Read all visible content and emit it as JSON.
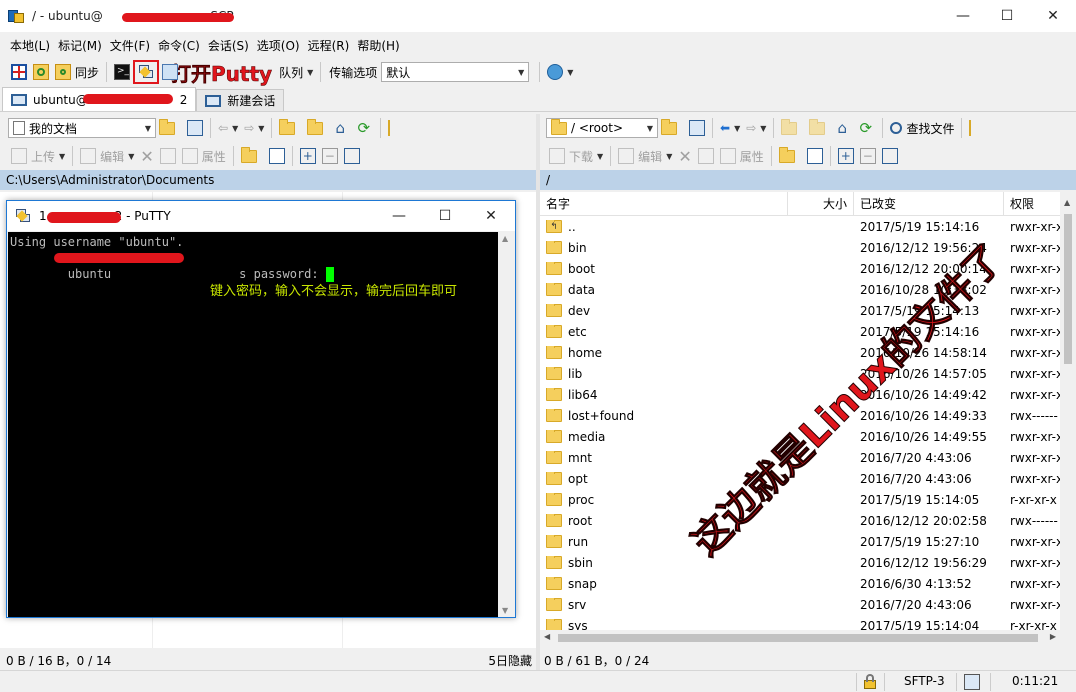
{
  "window": {
    "title_prefix": "/ - ubuntu@",
    "title_suffix": "nSCP",
    "minimize": "—",
    "maximize": "☐",
    "close": "✕"
  },
  "menu": [
    "本地(L)",
    "标记(M)",
    "文件(F)",
    "命令(C)",
    "会话(S)",
    "选项(O)",
    "远程(R)",
    "帮助(H)"
  ],
  "toolbar": {
    "sync_label": "同步",
    "queue_label": "队列",
    "transfer_label": "传输选项",
    "transfer_value": "默认"
  },
  "annotations": {
    "open_putty": "打开Putty",
    "linux_files": "这边就是Linux的文件了",
    "password_hint": "键入密码，输入不会显示，输完后回车即可"
  },
  "tabs": {
    "session_prefix": "ubuntu@",
    "session_suffix": "2",
    "new_session": "新建会话"
  },
  "left_panel": {
    "location": "我的文档",
    "upload": "上传",
    "edit": "编辑",
    "properties": "属性",
    "path": "C:\\Users\\Administrator\\Documents",
    "status": "0 B / 16 B，0 / 14",
    "hidden": "5日隐藏"
  },
  "right_panel": {
    "location": "/  <root>",
    "find_files": "查找文件",
    "download": "下载",
    "edit": "编辑",
    "properties": "属性",
    "path": "/",
    "columns": [
      "名字",
      "大小",
      "已改变",
      "权限"
    ],
    "files": [
      {
        "name": "..",
        "changed": "2017/5/19 15:14:16",
        "perm": "rwxr-xr-x",
        "up": true
      },
      {
        "name": "bin",
        "changed": "2016/12/12 19:56:24",
        "perm": "rwxr-xr-x"
      },
      {
        "name": "boot",
        "changed": "2016/12/12 20:00:14",
        "perm": "rwxr-xr-x"
      },
      {
        "name": "data",
        "changed": "2016/10/28 10:38:02",
        "perm": "rwxr-xr-x"
      },
      {
        "name": "dev",
        "changed": "2017/5/19 15:14:13",
        "perm": "rwxr-xr-x"
      },
      {
        "name": "etc",
        "changed": "2017/5/19 15:14:16",
        "perm": "rwxr-xr-x"
      },
      {
        "name": "home",
        "changed": "2016/10/26 14:58:14",
        "perm": "rwxr-xr-x"
      },
      {
        "name": "lib",
        "changed": "2016/10/26 14:57:05",
        "perm": "rwxr-xr-x"
      },
      {
        "name": "lib64",
        "changed": "2016/10/26 14:49:42",
        "perm": "rwxr-xr-x"
      },
      {
        "name": "lost+found",
        "changed": "2016/10/26 14:49:33",
        "perm": "rwx------"
      },
      {
        "name": "media",
        "changed": "2016/10/26 14:49:55",
        "perm": "rwxr-xr-x"
      },
      {
        "name": "mnt",
        "changed": "2016/7/20 4:43:06",
        "perm": "rwxr-xr-x"
      },
      {
        "name": "opt",
        "changed": "2016/7/20 4:43:06",
        "perm": "rwxr-xr-x"
      },
      {
        "name": "proc",
        "changed": "2017/5/19 15:14:05",
        "perm": "r-xr-xr-x"
      },
      {
        "name": "root",
        "changed": "2016/12/12 20:02:58",
        "perm": "rwx------"
      },
      {
        "name": "run",
        "changed": "2017/5/19 15:27:10",
        "perm": "rwxr-xr-x"
      },
      {
        "name": "sbin",
        "changed": "2016/12/12 19:56:29",
        "perm": "rwxr-xr-x"
      },
      {
        "name": "snap",
        "changed": "2016/6/30 4:13:52",
        "perm": "rwxr-xr-x"
      },
      {
        "name": "srv",
        "changed": "2016/7/20 4:43:06",
        "perm": "rwxr-xr-x"
      },
      {
        "name": "sys",
        "changed": "2017/5/19 15:14:04",
        "perm": "r-xr-xr-x"
      }
    ],
    "status": "0 B / 61 B，0 / 24"
  },
  "bottom": {
    "protocol": "SFTP-3",
    "time": "0:11:21"
  },
  "putty": {
    "title_prefix": "1",
    "title_suffix": "2 - PuTTY",
    "line1": "Using username \"ubuntu\".",
    "line2_prefix": "ubuntu",
    "line2_suffix": "s password: "
  },
  "colors": {
    "accent_red": "#e0161c",
    "path_bar": "#bcd2e8",
    "terminal_bg": "#000000",
    "terminal_cursor": "#00ff00",
    "annotation_text": "#c8e600"
  }
}
